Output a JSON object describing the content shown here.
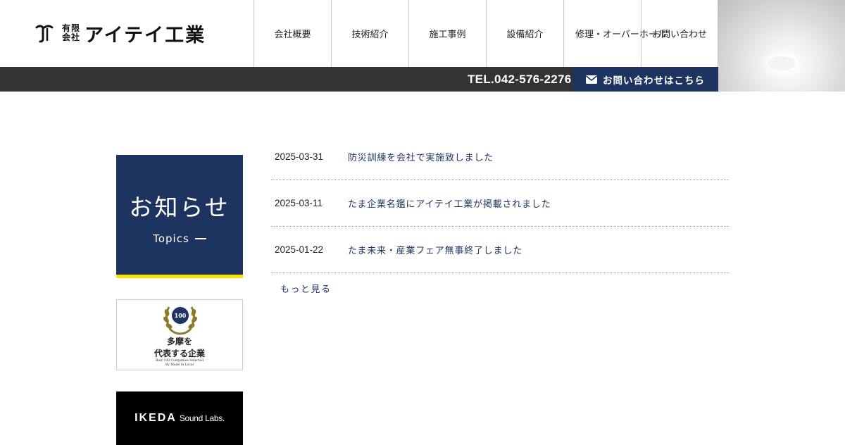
{
  "logo": {
    "small_top": "有限",
    "small_bottom": "会社",
    "name": "アイテイ工業"
  },
  "nav": {
    "items": [
      {
        "label": "会社概要"
      },
      {
        "label": "技術紹介"
      },
      {
        "label": "施工事例"
      },
      {
        "label": "設備紹介"
      },
      {
        "label": "修理・オーバーホール"
      },
      {
        "label": "お問い合わせ"
      }
    ]
  },
  "contact_bar": {
    "tel": "TEL.042-576-2276",
    "button_label": "お問い合わせはこちら",
    "button_icon": "mail-icon"
  },
  "sidebar": {
    "topics_title": "お知らせ",
    "topics_sub": "Topics",
    "badge": {
      "laurel_number": "100",
      "line1": "多摩を",
      "line2": "代表する企業",
      "small1": "Best 100 Companies Selected",
      "small2": "By Made In Local"
    },
    "ikeda": {
      "main": "IKEDA",
      "sub": "Sound Labs."
    }
  },
  "news": {
    "items": [
      {
        "date": "2025-03-31",
        "title": "防災訓練を会社で実施致しました"
      },
      {
        "date": "2025-03-11",
        "title": "たま企業名鑑にアイテイ工業が掲載されました"
      },
      {
        "date": "2025-01-22",
        "title": "たま未来・産業フェア無事終了しました"
      }
    ],
    "more_label": "もっと見る"
  },
  "colors": {
    "navy": "#1d3461",
    "strip": "#333333",
    "accent_yellow": "#f5e200"
  }
}
